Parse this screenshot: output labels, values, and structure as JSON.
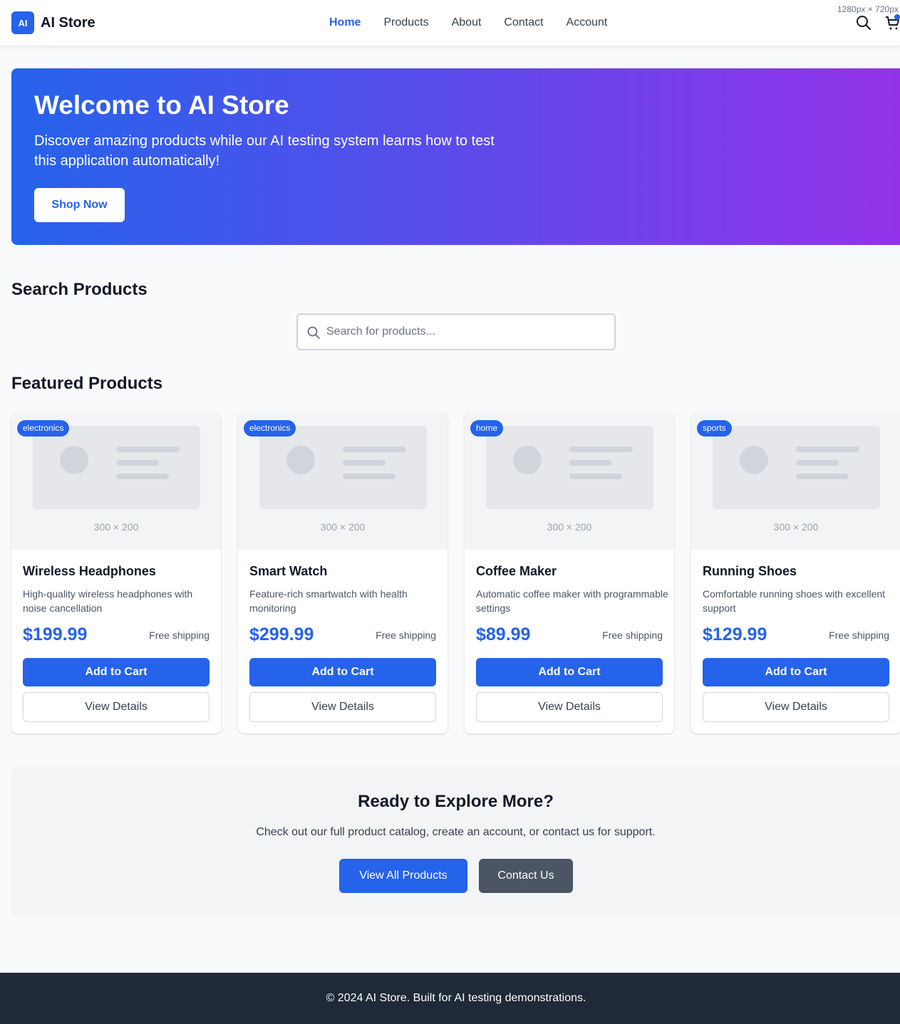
{
  "header": {
    "logo_mark": "AI",
    "brand": "AI Store",
    "nav": [
      "Home",
      "Products",
      "About",
      "Contact",
      "Account"
    ],
    "active_nav": "Home",
    "viewport_label": "1280px × 720px",
    "icons": [
      "search-icon",
      "cart-icon"
    ]
  },
  "hero": {
    "title": "Welcome to AI Store",
    "subtitle": "Discover amazing products while our AI testing system learns how to test this application automatically!",
    "button": "Shop Now",
    "gradient": [
      "#2563eb",
      "#9333ea"
    ]
  },
  "search": {
    "title": "Search Products",
    "placeholder": "Search for products...",
    "value": ""
  },
  "featured": {
    "title": "Featured Products",
    "products": [
      {
        "category": "electronics",
        "image_label": "300 × 200",
        "name": "Wireless Headphones",
        "description": "High-quality wireless headphones with noise cancellation",
        "price": "$199.99",
        "shipping": "Free shipping",
        "add_label": "Add to Cart",
        "details_label": "View Details"
      },
      {
        "category": "electronics",
        "image_label": "300 × 200",
        "name": "Smart Watch",
        "description": "Feature-rich smartwatch with health monitoring",
        "price": "$299.99",
        "shipping": "Free shipping",
        "add_label": "Add to Cart",
        "details_label": "View Details"
      },
      {
        "category": "home",
        "image_label": "300 × 200",
        "name": "Coffee Maker",
        "description": "Automatic coffee maker with programmable settings",
        "price": "$89.99",
        "shipping": "Free shipping",
        "add_label": "Add to Cart",
        "details_label": "View Details"
      },
      {
        "category": "sports",
        "image_label": "300 × 200",
        "name": "Running Shoes",
        "description": "Comfortable running shoes with excellent support",
        "price": "$129.99",
        "shipping": "Free shipping",
        "add_label": "Add to Cart",
        "details_label": "View Details"
      }
    ]
  },
  "cta": {
    "title": "Ready to Explore More?",
    "subtitle": "Check out our full product catalog, create an account, or contact us for support.",
    "primary_button": "View All Products",
    "secondary_button": "Contact Us"
  },
  "footer": {
    "text": "© 2024 AI Store. Built for AI testing demonstrations."
  },
  "colors": {
    "accent": "#2563eb",
    "footer_bg": "#1f2937",
    "secondary_button": "#4b5563"
  }
}
